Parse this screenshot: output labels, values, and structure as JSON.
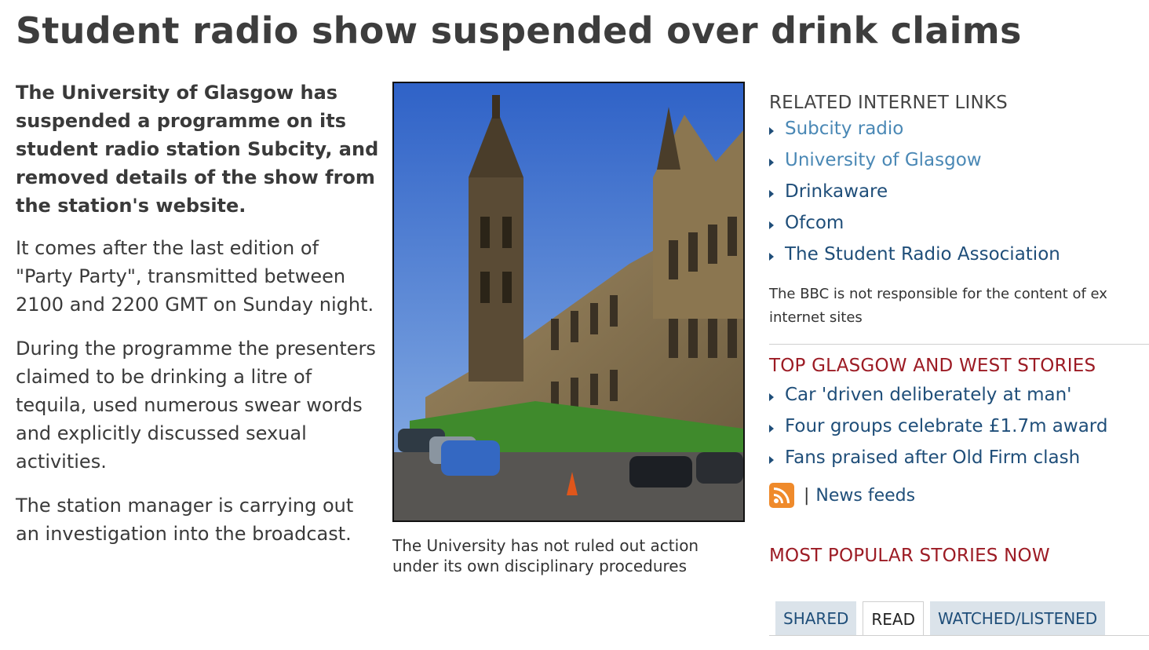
{
  "article": {
    "headline": "Student radio show suspended over drink claims",
    "paragraphs": [
      "The University of Glasgow has suspended a programme on its student radio station Subcity, and removed details of the show from the station's website.",
      "It comes after the last edition of \"Party Party\", transmitted between 2100 and 2200 GMT on Sunday night.",
      "During the programme the presenters claimed to be drinking a litre of tequila, used numerous swear words and explicitly discussed sexual activities.",
      "The station manager is carrying out an investigation into the broadcast."
    ],
    "photo_caption": "The University has not ruled out action under its own disciplinary procedures"
  },
  "related": {
    "heading": "RELATED INTERNET LINKS",
    "links": [
      "Subcity radio",
      "University of Glasgow",
      "Drinkaware",
      "Ofcom",
      "The Student Radio Association"
    ],
    "disclaimer_line1": "The BBC is not responsible for the content of ex",
    "disclaimer_line2": "internet sites"
  },
  "top_stories": {
    "heading": "TOP GLASGOW AND WEST STORIES",
    "items": [
      "Car 'driven deliberately at man'",
      "Four groups celebrate £1.7m award",
      "Fans praised after Old Firm clash"
    ],
    "feeds_separator": "|",
    "feeds_label": "News feeds"
  },
  "most_popular": {
    "heading": "MOST POPULAR STORIES NOW",
    "tabs": [
      "SHARED",
      "READ",
      "WATCHED/LISTENED"
    ],
    "active_tab": "READ"
  },
  "colors": {
    "headline": "#3d3d3d",
    "section_red": "#9c1b24",
    "link_light": "#4a88b5",
    "link_dark": "#1f4e79",
    "rss_orange": "#ef8a2b"
  }
}
